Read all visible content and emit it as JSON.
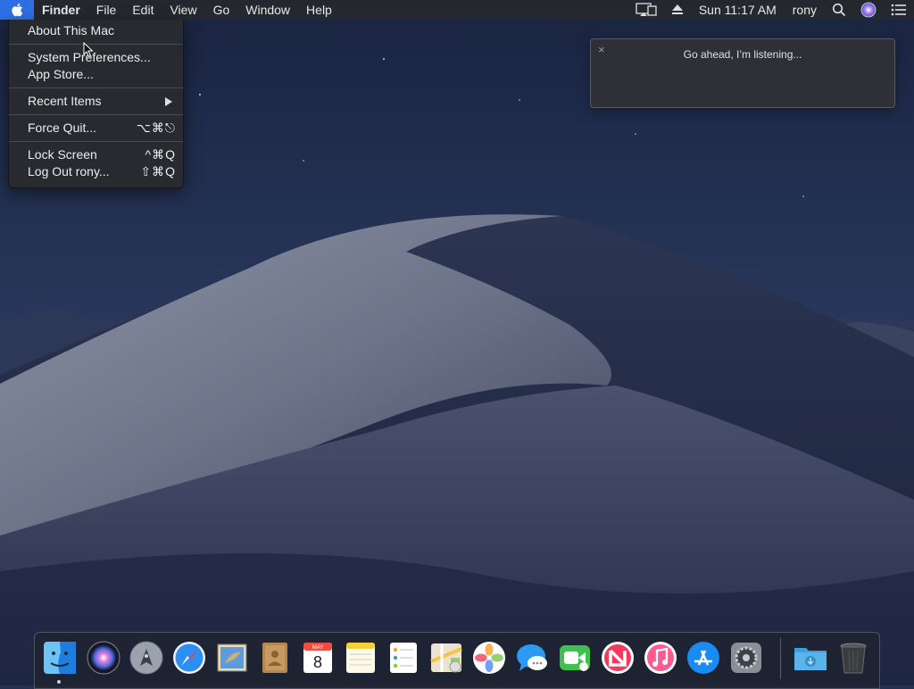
{
  "menubar": {
    "app_name": "Finder",
    "menus": [
      "File",
      "Edit",
      "View",
      "Go",
      "Window",
      "Help"
    ],
    "clock": "Sun 11:17 AM",
    "user": "rony"
  },
  "apple_menu": {
    "about": "About This Mac",
    "system_preferences": "System Preferences...",
    "app_store": "App Store...",
    "recent_items": "Recent Items",
    "force_quit": "Force Quit...",
    "force_quit_shortcut": "⌥⌘⎋",
    "lock_screen": "Lock Screen",
    "lock_screen_shortcut": "^⌘Q",
    "log_out": "Log Out rony...",
    "log_out_shortcut": "⇧⌘Q"
  },
  "siri": {
    "message": "Go ahead, I’m listening...",
    "close_glyph": "×"
  },
  "dock": {
    "items": [
      "finder-icon",
      "siri-icon",
      "launchpad-icon",
      "safari-icon",
      "mail-icon",
      "contacts-icon",
      "calendar-icon",
      "notes-icon",
      "reminders-icon",
      "maps-icon",
      "photos-icon",
      "messages-icon",
      "facetime-icon",
      "news-icon",
      "itunes-icon",
      "app-store-icon",
      "system-preferences-icon",
      "downloads-folder-icon",
      "trash-icon"
    ],
    "calendar_month": "MAY",
    "calendar_day": "8"
  },
  "colors": {
    "menubar_bg": "#26282c",
    "apple_highlight": "#2f6fe4",
    "menu_bg": "#282a2e",
    "accent": "#2f6fe4"
  }
}
